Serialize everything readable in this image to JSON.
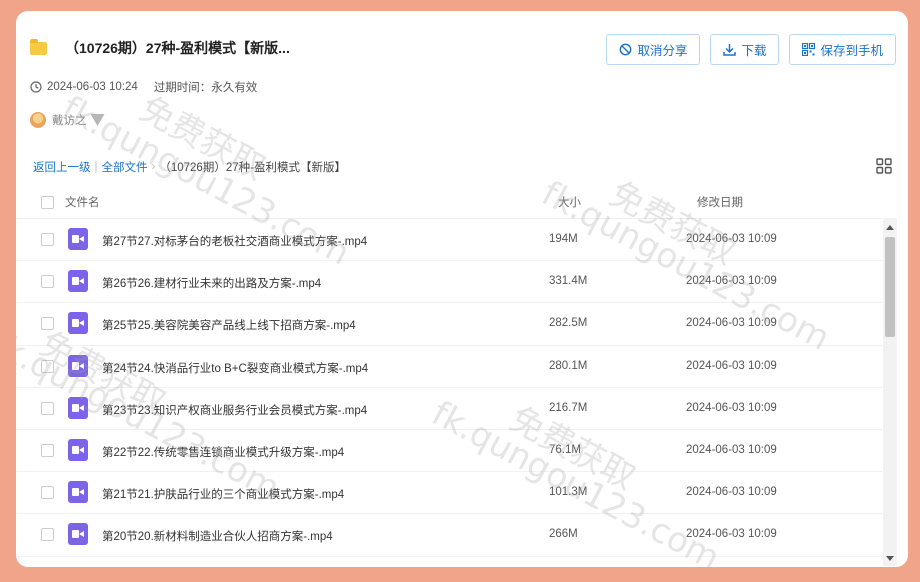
{
  "header": {
    "title": "（10726期）27种-盈利模式【新版...",
    "actions": {
      "cancel_share": "取消分享",
      "download": "下载",
      "save_phone": "保存到手机"
    },
    "date": "2024-06-03 10:24",
    "expire_label": "过期时间：永久有效",
    "user_name": "戴访之"
  },
  "breadcrumb": {
    "back": "返回上一级",
    "all_files": "全部文件",
    "current": "（10726期）27种-盈利模式【新版】"
  },
  "table": {
    "headers": {
      "name": "文件名",
      "size": "大小",
      "date": "修改日期"
    },
    "rows": [
      {
        "name": "第27节27.对标茅台的老板社交酒商业模式方案-.mp4",
        "size": "194M",
        "date": "2024-06-03 10:09"
      },
      {
        "name": "第26节26.建材行业未来的出路及方案-.mp4",
        "size": "331.4M",
        "date": "2024-06-03 10:09"
      },
      {
        "name": "第25节25.美容院美容产品线上线下招商方案-.mp4",
        "size": "282.5M",
        "date": "2024-06-03 10:09"
      },
      {
        "name": "第24节24.快消品行业to B+C裂变商业模式方案-.mp4",
        "size": "280.1M",
        "date": "2024-06-03 10:09"
      },
      {
        "name": "第23节23.知识产权商业服务行业会员模式方案-.mp4",
        "size": "216.7M",
        "date": "2024-06-03 10:09"
      },
      {
        "name": "第22节22.传统零售连锁商业模式升级方案-.mp4",
        "size": "76.1M",
        "date": "2024-06-03 10:09"
      },
      {
        "name": "第21节21.护肤品行业的三个商业模式方案-.mp4",
        "size": "101.3M",
        "date": "2024-06-03 10:09"
      },
      {
        "name": "第20节20.新材料制造业合伙人招商方案-.mp4",
        "size": "266M",
        "date": "2024-06-03 10:09"
      }
    ]
  },
  "watermark": {
    "cn": "免费获取",
    "url": "fk.qungou123.com"
  },
  "icons": {
    "folder": "folder-icon",
    "cancel": "cancel-share-icon",
    "download": "download-icon",
    "qrcode": "qrcode-icon",
    "clock": "clock-icon",
    "video": "video-file-icon",
    "grid": "grid-view-icon"
  },
  "colors": {
    "background": "#f0a58a",
    "accent": "#1a73c9",
    "video_icon": "#7c63e8"
  }
}
